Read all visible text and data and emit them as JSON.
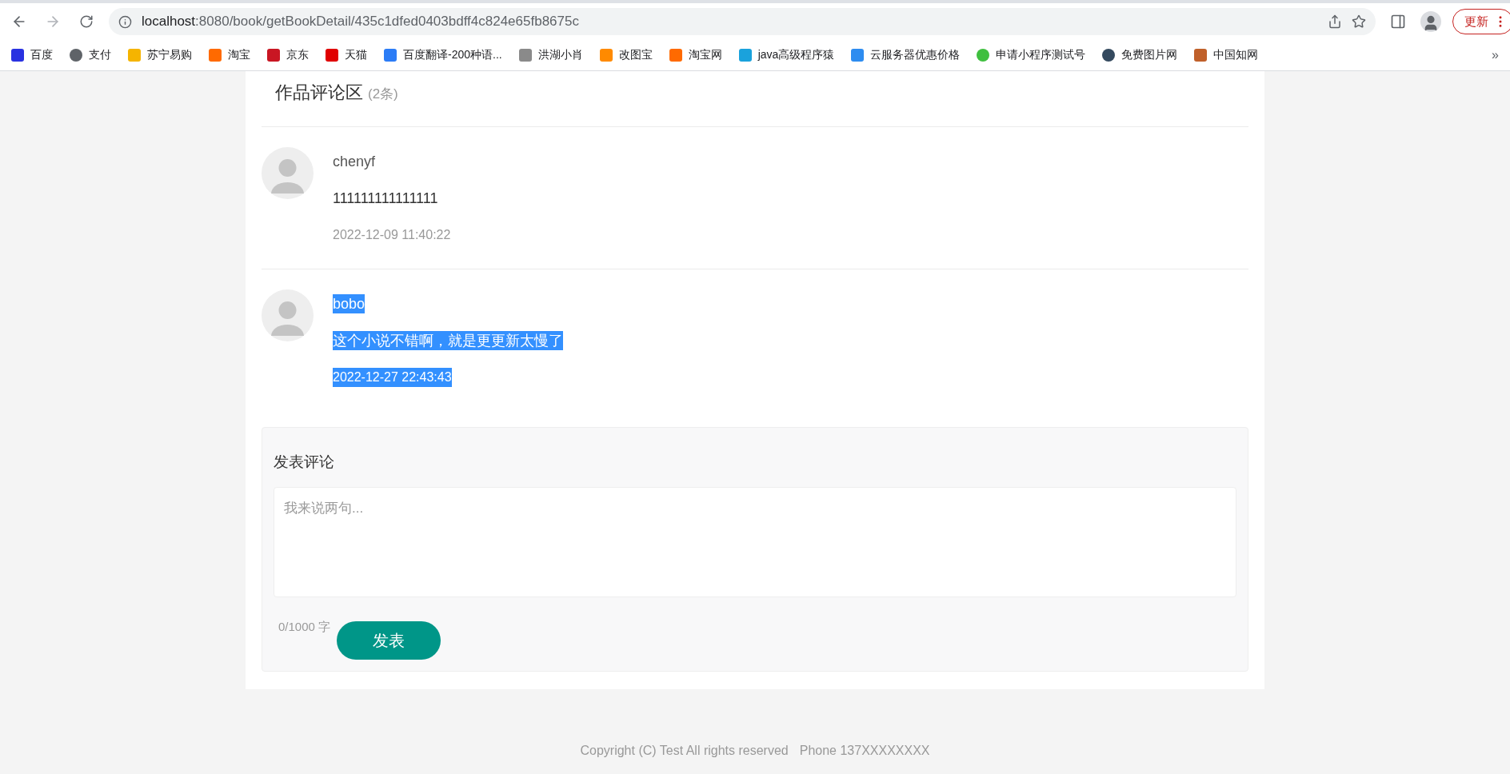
{
  "browser": {
    "url_host": "localhost",
    "url_path": ":8080/book/getBookDetail/435c1dfed0403bdff4c824e65fb8675c",
    "update_label": "更新",
    "more_label": "»"
  },
  "bookmarks": [
    {
      "label": "百度",
      "color": "#2932e1"
    },
    {
      "label": "支付",
      "color": "#5f6368"
    },
    {
      "label": "苏宁易购",
      "color": "#f5b400"
    },
    {
      "label": "淘宝",
      "color": "#ff6a00"
    },
    {
      "label": "京东",
      "color": "#c91623"
    },
    {
      "label": "天猫",
      "color": "#e00000"
    },
    {
      "label": "百度翻译-200种语...",
      "color": "#2b7cf6"
    },
    {
      "label": "洪湖小肖",
      "color": "#8a8a8a"
    },
    {
      "label": "改图宝",
      "color": "#ff8a00"
    },
    {
      "label": "淘宝网",
      "color": "#ff6a00"
    },
    {
      "label": "java高级程序猿",
      "color": "#1aa2dc"
    },
    {
      "label": "云服务器优惠价格",
      "color": "#2d8cf0"
    },
    {
      "label": "申请小程序测试号",
      "color": "#3fbf3f"
    },
    {
      "label": "免费图片网",
      "color": "#34495e"
    },
    {
      "label": "中国知网",
      "color": "#c0602a"
    }
  ],
  "comments_section": {
    "title": "作品评论区",
    "count": "(2条)",
    "comments": [
      {
        "user": "chenyf",
        "text": "111111111111111",
        "time": "2022-12-09 11:40:22",
        "selected": false
      },
      {
        "user": "bobo",
        "text": "这个小说不错啊，就是更更新太慢了",
        "time": "2022-12-27 22:43:43",
        "selected": true
      }
    ]
  },
  "compose": {
    "title": "发表评论",
    "placeholder": "我来说两句...",
    "counter": "0/1000 字",
    "submit": "发表"
  },
  "footer": {
    "copyright": "Copyright (C) Test All rights reserved",
    "phone": "Phone 137XXXXXXXX"
  }
}
